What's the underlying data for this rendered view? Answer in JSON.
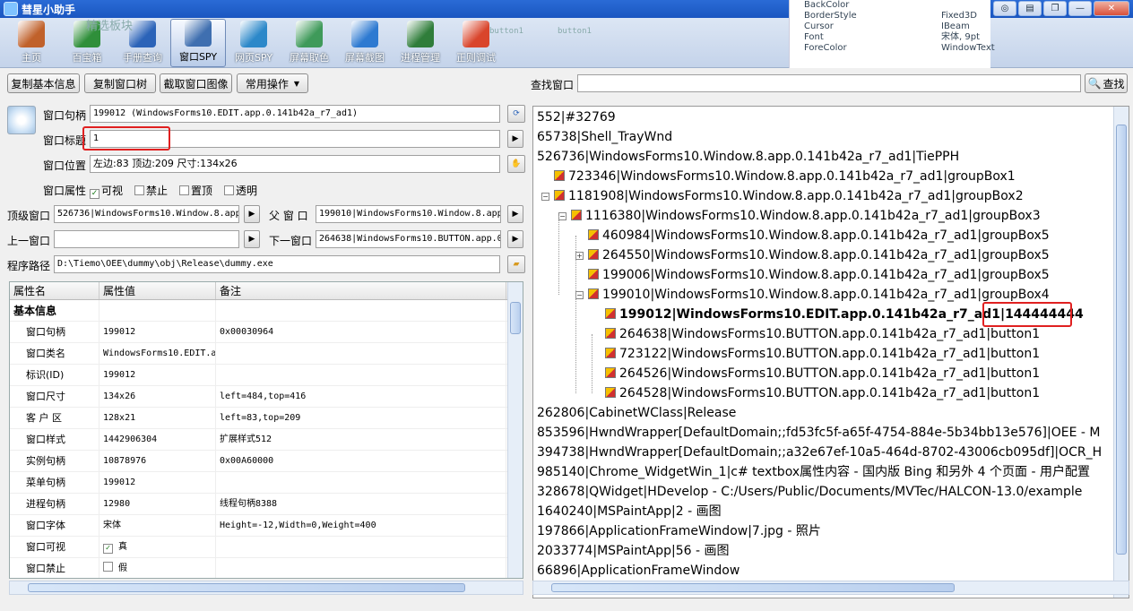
{
  "window": {
    "title": "彗星小助手"
  },
  "toolbar": {
    "items": [
      {
        "label": "主页",
        "icon": "home-icon",
        "color": "#c0612b"
      },
      {
        "label": "百宝箱",
        "icon": "toolbox-icon",
        "color": "#2f8f3a"
      },
      {
        "label": "手册查询",
        "icon": "help-icon",
        "color": "#2b63b8"
      },
      {
        "label": "窗口SPY",
        "icon": "window-spy-icon",
        "color": "#3f6fb0"
      },
      {
        "label": "网页SPY",
        "icon": "web-spy-icon",
        "color": "#2c88c9"
      },
      {
        "label": "屏幕取色",
        "icon": "color-picker-icon",
        "color": "#3f9a5a"
      },
      {
        "label": "屏幕截图",
        "icon": "screenshot-icon",
        "color": "#2e7ad1"
      },
      {
        "label": "进程管理",
        "icon": "process-icon",
        "color": "#2f7d3a"
      },
      {
        "label": "正则调试",
        "icon": "regex-icon",
        "color": "#d9452c"
      }
    ],
    "bg_text": {
      "a": "精选板块",
      "b": "button1",
      "c": "button1"
    }
  },
  "prop_fragment": {
    "names": [
      "BackColor",
      "BorderStyle",
      "Cursor",
      "Font",
      "ForeColor"
    ],
    "values": [
      "",
      "Fixed3D",
      "IBeam",
      "宋体, 9pt",
      "WindowText"
    ]
  },
  "actions": {
    "copy_basic": "复制基本信息",
    "copy_tree": "复制窗口树",
    "capture": "截取窗口图像",
    "common": "常用操作",
    "find_label": "查找窗口",
    "find_button": "查找"
  },
  "info": {
    "handle_label": "窗口句柄",
    "handle_value": "199012 (WindowsForms10.EDIT.app.0.141b42a_r7_ad1)",
    "title_label": "窗口标题",
    "title_value": "1",
    "pos_label": "窗口位置",
    "pos_value": "左边:83 顶边:209 尺寸:134x26",
    "attr_label": "窗口属性",
    "attr_visible": "可视",
    "attr_disabled": "禁止",
    "attr_top": "置顶",
    "attr_transparent": "透明",
    "top_label": "顶级窗口",
    "top_value": "526736|WindowsForms10.Window.8.app.0.141b42a_r7_ad1",
    "parent_label": "父 窗 口",
    "parent_value": "199010|WindowsForms10.Window.8.app.0.141b42a_r7_ad1",
    "prev_label": "上一窗口",
    "prev_value": "",
    "next_label": "下一窗口",
    "next_value": "264638|WindowsForms10.BUTTON.app.0.141b42a_r7_ad1",
    "path_label": "程序路径",
    "path_value": "D:\\Tiemo\\OEE\\dummy\\obj\\Release\\dummy.exe"
  },
  "ptable": {
    "headers": [
      "属性名",
      "属性值",
      "备注"
    ],
    "group": "基本信息",
    "rows": [
      [
        "窗口句柄",
        "199012",
        "0x00030964"
      ],
      [
        "窗口类名",
        "WindowsForms10.EDIT.a",
        ""
      ],
      [
        "标识(ID)",
        "199012",
        ""
      ],
      [
        "窗口尺寸",
        "134x26",
        "left=484,top=416"
      ],
      [
        "客 户 区",
        "128x21",
        "left=83,top=209"
      ],
      [
        "窗口样式",
        "1442906304",
        "扩展样式512"
      ],
      [
        "实例句柄",
        "10878976",
        "0x00A60000"
      ],
      [
        "菜单句柄",
        "199012",
        ""
      ],
      [
        "进程句柄",
        "12980",
        "线程句柄8388"
      ],
      [
        "窗口字体",
        "宋体",
        "Height=-12,Width=0,Weight=400"
      ],
      [
        "窗口可视",
        "真",
        ""
      ],
      [
        "窗口禁止",
        "假",
        ""
      ]
    ]
  },
  "tree": {
    "nodes": [
      "552|#32769",
      "65738|Shell_TrayWnd",
      "526736|WindowsForms10.Window.8.app.0.141b42a_r7_ad1|TiePPH",
      "723346|WindowsForms10.Window.8.app.0.141b42a_r7_ad1|groupBox1",
      "1181908|WindowsForms10.Window.8.app.0.141b42a_r7_ad1|groupBox2",
      "1116380|WindowsForms10.Window.8.app.0.141b42a_r7_ad1|groupBox3",
      "460984|WindowsForms10.Window.8.app.0.141b42a_r7_ad1|groupBox5",
      "264550|WindowsForms10.Window.8.app.0.141b42a_r7_ad1|groupBox5",
      "199006|WindowsForms10.Window.8.app.0.141b42a_r7_ad1|groupBox5",
      "199010|WindowsForms10.Window.8.app.0.141b42a_r7_ad1|groupBox4",
      "199012|WindowsForms10.EDIT.app.0.141b42a_r7_ad1|144444444",
      "264638|WindowsForms10.BUTTON.app.0.141b42a_r7_ad1|button1",
      "723122|WindowsForms10.BUTTON.app.0.141b42a_r7_ad1|button1",
      "264526|WindowsForms10.BUTTON.app.0.141b42a_r7_ad1|button1",
      "264528|WindowsForms10.BUTTON.app.0.141b42a_r7_ad1|button1",
      "262806|CabinetWClass|Release",
      "853596|HwndWrapper[DefaultDomain;;fd53fc5f-a65f-4754-884e-5b34bb13e576]|OEE - M",
      "394738|HwndWrapper[DefaultDomain;;a32e67ef-10a5-464d-8702-43006cb095df]|OCR_H",
      "985140|Chrome_WidgetWin_1|c# textbox属性内容 - 国内版 Bing 和另外 4 个页面 - 用户配置",
      "328678|QWidget|HDevelop - C:/Users/Public/Documents/MVTec/HALCON-13.0/example",
      "1640240|MSPaintApp|2 - 画图",
      "197866|ApplicationFrameWindow|7.jpg - 照片",
      "2033774|MSPaintApp|56 - 画图",
      "66896|ApplicationFrameWindow"
    ]
  }
}
